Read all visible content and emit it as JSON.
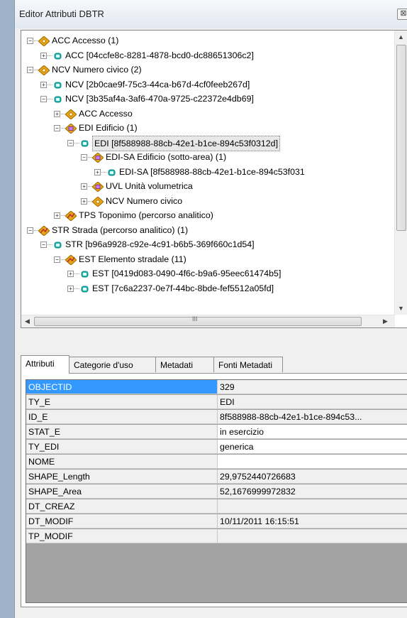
{
  "window": {
    "title": "Editor Attributi DBTR",
    "close_symbol": "⊠"
  },
  "tree": {
    "nodes": [
      {
        "label": "ACC Accesso (1)",
        "expander": "−",
        "icon": "class-icon"
      },
      {
        "label": "ACC [04ccfe8c-8281-4878-bcd0-dc88651306c2]",
        "expander": "+",
        "icon": "feature-icon"
      },
      {
        "label": "NCV Numero civico (2)",
        "expander": "−",
        "icon": "class-icon"
      },
      {
        "label": "NCV [2b0cae9f-75c3-44ca-b67d-4cf0feeb267d]",
        "expander": "+",
        "icon": "feature-icon"
      },
      {
        "label": "NCV [3b35af4a-3af6-470a-9725-c22372e4db69]",
        "expander": "−",
        "icon": "feature-icon"
      },
      {
        "label": "ACC Accesso",
        "expander": "+",
        "icon": "class-icon"
      },
      {
        "label": "EDI Edificio (1)",
        "expander": "−",
        "icon": "polygon-class-icon"
      },
      {
        "label": "EDI [8f588988-88cb-42e1-b1ce-894c53f0312d]",
        "expander": "−",
        "icon": "feature-icon"
      },
      {
        "label": "EDI-SA Edificio (sotto-area) (1)",
        "expander": "−",
        "icon": "polygon-class-icon"
      },
      {
        "label": "EDI-SA [8f588988-88cb-42e1-b1ce-894c53f031",
        "expander": "+",
        "icon": "feature-icon"
      },
      {
        "label": "UVL Unità volumetrica",
        "expander": "+",
        "icon": "polygon-class-icon"
      },
      {
        "label": "NCV Numero civico",
        "expander": "+",
        "icon": "class-icon"
      },
      {
        "label": "TPS Toponimo (percorso analitico)",
        "expander": "+",
        "icon": "line-class-icon"
      },
      {
        "label": "STR Strada (percorso analitico) (1)",
        "expander": "−",
        "icon": "line-class-icon"
      },
      {
        "label": "STR [b96a9928-c92e-4c91-b6b5-369f660c1d54]",
        "expander": "−",
        "icon": "feature-icon"
      },
      {
        "label": "EST Elemento stradale (11)",
        "expander": "−",
        "icon": "line-class-icon"
      },
      {
        "label": "EST [0419d083-0490-4f6c-b9a6-95eec61474b5]",
        "expander": "+",
        "icon": "feature-icon"
      },
      {
        "label": "EST [7c6a2237-0e7f-44bc-8bde-fef5512a05fd]",
        "expander": "+",
        "icon": "feature-icon"
      }
    ],
    "hscroll_grip": "III"
  },
  "tabs": [
    {
      "label": "Attributi",
      "active": true
    },
    {
      "label": "Categorie d'uso",
      "active": false
    },
    {
      "label": "Metadati",
      "active": false
    },
    {
      "label": "Fonti Metadati",
      "active": false
    }
  ],
  "attributes": [
    {
      "name": "OBJECTID",
      "value": "329"
    },
    {
      "name": "TY_E",
      "value": "EDI"
    },
    {
      "name": "ID_E",
      "value": "8f588988-88cb-42e1-b1ce-894c53..."
    },
    {
      "name": "STAT_E",
      "value": "in esercizio"
    },
    {
      "name": "TY_EDI",
      "value": "generica"
    },
    {
      "name": "NOME",
      "value": ""
    },
    {
      "name": "SHAPE_Length",
      "value": "29,9752440726683"
    },
    {
      "name": "SHAPE_Area",
      "value": "52,1676999972832"
    },
    {
      "name": "DT_CREAZ",
      "value": ""
    },
    {
      "name": "DT_MODIF",
      "value": "10/11/2011 16:15:51"
    },
    {
      "name": "TP_MODIF",
      "value": ""
    }
  ],
  "colors": {
    "class_icon": "#e8a317",
    "feature_icon": "#1fbfb8",
    "selection": "#3399ff"
  }
}
